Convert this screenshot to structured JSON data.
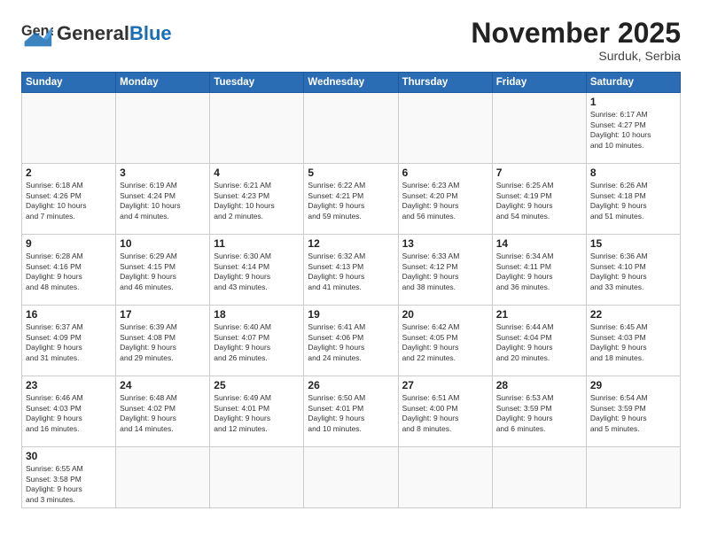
{
  "header": {
    "logo_general": "General",
    "logo_blue": "Blue",
    "title": "November 2025",
    "subtitle": "Surduk, Serbia"
  },
  "weekdays": [
    "Sunday",
    "Monday",
    "Tuesday",
    "Wednesday",
    "Thursday",
    "Friday",
    "Saturday"
  ],
  "weeks": [
    [
      {
        "day": "",
        "info": "",
        "empty": true
      },
      {
        "day": "",
        "info": "",
        "empty": true
      },
      {
        "day": "",
        "info": "",
        "empty": true
      },
      {
        "day": "",
        "info": "",
        "empty": true
      },
      {
        "day": "",
        "info": "",
        "empty": true
      },
      {
        "day": "",
        "info": "",
        "empty": true
      },
      {
        "day": "1",
        "info": "Sunrise: 6:17 AM\nSunset: 4:27 PM\nDaylight: 10 hours\nand 10 minutes."
      }
    ],
    [
      {
        "day": "2",
        "info": "Sunrise: 6:18 AM\nSunset: 4:26 PM\nDaylight: 10 hours\nand 7 minutes."
      },
      {
        "day": "3",
        "info": "Sunrise: 6:19 AM\nSunset: 4:24 PM\nDaylight: 10 hours\nand 4 minutes."
      },
      {
        "day": "4",
        "info": "Sunrise: 6:21 AM\nSunset: 4:23 PM\nDaylight: 10 hours\nand 2 minutes."
      },
      {
        "day": "5",
        "info": "Sunrise: 6:22 AM\nSunset: 4:21 PM\nDaylight: 9 hours\nand 59 minutes."
      },
      {
        "day": "6",
        "info": "Sunrise: 6:23 AM\nSunset: 4:20 PM\nDaylight: 9 hours\nand 56 minutes."
      },
      {
        "day": "7",
        "info": "Sunrise: 6:25 AM\nSunset: 4:19 PM\nDaylight: 9 hours\nand 54 minutes."
      },
      {
        "day": "8",
        "info": "Sunrise: 6:26 AM\nSunset: 4:18 PM\nDaylight: 9 hours\nand 51 minutes."
      }
    ],
    [
      {
        "day": "9",
        "info": "Sunrise: 6:28 AM\nSunset: 4:16 PM\nDaylight: 9 hours\nand 48 minutes."
      },
      {
        "day": "10",
        "info": "Sunrise: 6:29 AM\nSunset: 4:15 PM\nDaylight: 9 hours\nand 46 minutes."
      },
      {
        "day": "11",
        "info": "Sunrise: 6:30 AM\nSunset: 4:14 PM\nDaylight: 9 hours\nand 43 minutes."
      },
      {
        "day": "12",
        "info": "Sunrise: 6:32 AM\nSunset: 4:13 PM\nDaylight: 9 hours\nand 41 minutes."
      },
      {
        "day": "13",
        "info": "Sunrise: 6:33 AM\nSunset: 4:12 PM\nDaylight: 9 hours\nand 38 minutes."
      },
      {
        "day": "14",
        "info": "Sunrise: 6:34 AM\nSunset: 4:11 PM\nDaylight: 9 hours\nand 36 minutes."
      },
      {
        "day": "15",
        "info": "Sunrise: 6:36 AM\nSunset: 4:10 PM\nDaylight: 9 hours\nand 33 minutes."
      }
    ],
    [
      {
        "day": "16",
        "info": "Sunrise: 6:37 AM\nSunset: 4:09 PM\nDaylight: 9 hours\nand 31 minutes."
      },
      {
        "day": "17",
        "info": "Sunrise: 6:39 AM\nSunset: 4:08 PM\nDaylight: 9 hours\nand 29 minutes."
      },
      {
        "day": "18",
        "info": "Sunrise: 6:40 AM\nSunset: 4:07 PM\nDaylight: 9 hours\nand 26 minutes."
      },
      {
        "day": "19",
        "info": "Sunrise: 6:41 AM\nSunset: 4:06 PM\nDaylight: 9 hours\nand 24 minutes."
      },
      {
        "day": "20",
        "info": "Sunrise: 6:42 AM\nSunset: 4:05 PM\nDaylight: 9 hours\nand 22 minutes."
      },
      {
        "day": "21",
        "info": "Sunrise: 6:44 AM\nSunset: 4:04 PM\nDaylight: 9 hours\nand 20 minutes."
      },
      {
        "day": "22",
        "info": "Sunrise: 6:45 AM\nSunset: 4:03 PM\nDaylight: 9 hours\nand 18 minutes."
      }
    ],
    [
      {
        "day": "23",
        "info": "Sunrise: 6:46 AM\nSunset: 4:03 PM\nDaylight: 9 hours\nand 16 minutes."
      },
      {
        "day": "24",
        "info": "Sunrise: 6:48 AM\nSunset: 4:02 PM\nDaylight: 9 hours\nand 14 minutes."
      },
      {
        "day": "25",
        "info": "Sunrise: 6:49 AM\nSunset: 4:01 PM\nDaylight: 9 hours\nand 12 minutes."
      },
      {
        "day": "26",
        "info": "Sunrise: 6:50 AM\nSunset: 4:01 PM\nDaylight: 9 hours\nand 10 minutes."
      },
      {
        "day": "27",
        "info": "Sunrise: 6:51 AM\nSunset: 4:00 PM\nDaylight: 9 hours\nand 8 minutes."
      },
      {
        "day": "28",
        "info": "Sunrise: 6:53 AM\nSunset: 3:59 PM\nDaylight: 9 hours\nand 6 minutes."
      },
      {
        "day": "29",
        "info": "Sunrise: 6:54 AM\nSunset: 3:59 PM\nDaylight: 9 hours\nand 5 minutes."
      }
    ],
    [
      {
        "day": "30",
        "info": "Sunrise: 6:55 AM\nSunset: 3:58 PM\nDaylight: 9 hours\nand 3 minutes."
      },
      {
        "day": "",
        "info": "",
        "empty": true
      },
      {
        "day": "",
        "info": "",
        "empty": true
      },
      {
        "day": "",
        "info": "",
        "empty": true
      },
      {
        "day": "",
        "info": "",
        "empty": true
      },
      {
        "day": "",
        "info": "",
        "empty": true
      },
      {
        "day": "",
        "info": "",
        "empty": true
      }
    ]
  ]
}
